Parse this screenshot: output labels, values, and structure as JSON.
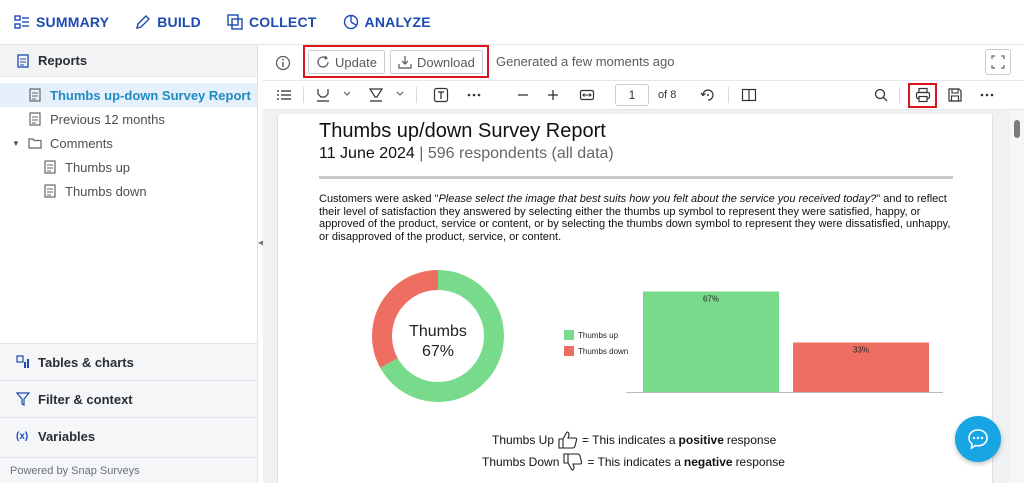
{
  "nav": {
    "items": [
      {
        "label": "SUMMARY",
        "icon": "summary-icon"
      },
      {
        "label": "BUILD",
        "icon": "pencil-icon"
      },
      {
        "label": "COLLECT",
        "icon": "collect-icon"
      },
      {
        "label": "ANALYZE",
        "icon": "analyze-icon"
      }
    ]
  },
  "sidebar": {
    "header": "Reports",
    "tree": [
      {
        "label": "Thumbs up-down Survey Report",
        "level": 0,
        "active": true,
        "icon": "document-icon"
      },
      {
        "label": "Previous 12 months",
        "level": 0,
        "active": false,
        "icon": "document-icon"
      },
      {
        "label": "Comments",
        "level": 0,
        "active": false,
        "icon": "folder-icon",
        "expanded": true
      },
      {
        "label": "Thumbs up",
        "level": 1,
        "active": false,
        "icon": "document-icon"
      },
      {
        "label": "Thumbs down",
        "level": 1,
        "active": false,
        "icon": "document-icon"
      }
    ],
    "sections": [
      {
        "label": "Tables & charts",
        "icon": "tables-icon"
      },
      {
        "label": "Filter & context",
        "icon": "filter-icon"
      },
      {
        "label": "Variables",
        "icon": "variables-icon"
      }
    ],
    "footer": "Powered by Snap Surveys"
  },
  "toolbar": {
    "update_label": "Update",
    "download_label": "Download",
    "generated_text": "Generated a few moments ago"
  },
  "pdf_toolbar": {
    "page_current": "1",
    "page_total_text": "of 8"
  },
  "report": {
    "title": "Thumbs up/down Survey Report",
    "date": "11 June 2024",
    "separator": "|",
    "respondents": "596 respondents (all data)",
    "body_prefix": "Customers were asked \"",
    "body_question": "Please select the image that best suits how you felt about the service you received today?",
    "body_rest": "\" and to reflect their level of satisfaction they answered by selecting either the thumbs up symbol to represent they were satisfied, happy, or approved of the product, service or content, or by selecting the thumbs down symbol to represent they were dissatisfied, unhappy, or disapproved of the product, service, or content.",
    "donut_center_label": "Thumbs",
    "donut_center_value": "67%",
    "thumbs_up_label": "Thumbs Up",
    "thumbs_up_text_pre": "= This indicates a",
    "thumbs_up_bold": "positive",
    "thumbs_up_text_post": "response",
    "thumbs_down_label": "Thumbs Down",
    "thumbs_down_text_pre": "= This indicates a",
    "thumbs_down_bold": "negative",
    "thumbs_down_text_post": "response"
  },
  "colors": {
    "thumbs_up": "#78db8b",
    "thumbs_down": "#ee6e62",
    "accent": "#1d4ab0",
    "highlight": "#d9161e",
    "chat": "#18a5e3"
  },
  "chart_data": [
    {
      "type": "pie",
      "categories": [
        "Thumbs up",
        "Thumbs down"
      ],
      "values": [
        67,
        33
      ],
      "unit": "%"
    },
    {
      "type": "bar",
      "categories": [
        "Thumbs up",
        "Thumbs down"
      ],
      "values": [
        67,
        33
      ],
      "data_labels": [
        "67%",
        "33%"
      ],
      "legend": [
        "Thumbs up",
        "Thumbs down"
      ],
      "legend_position": "left",
      "ylim": [
        0,
        100
      ]
    }
  ]
}
